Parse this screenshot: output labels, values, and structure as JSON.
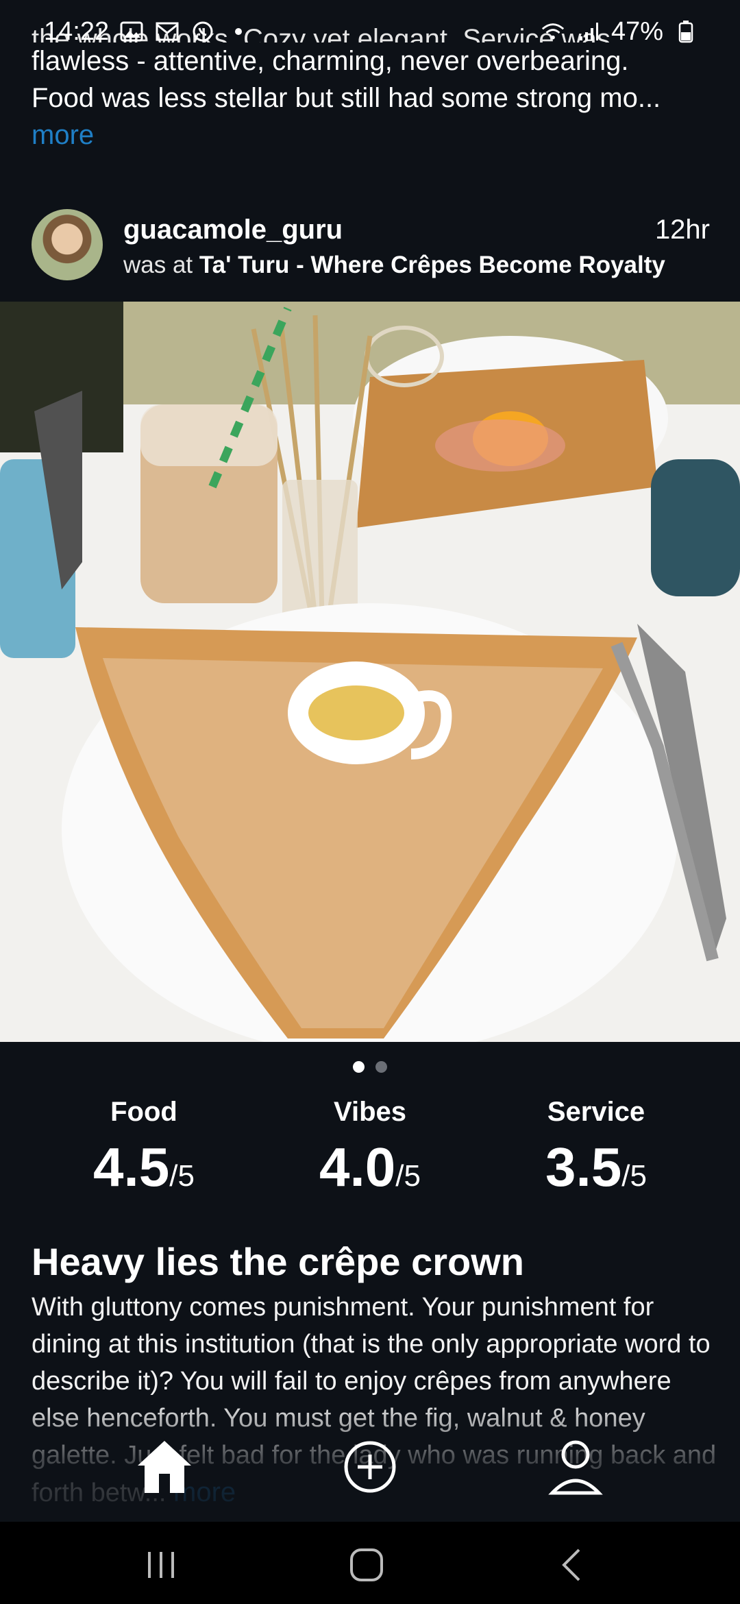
{
  "status_bar": {
    "time": "14:22",
    "battery": "47%",
    "icons_left": [
      "gallery-icon",
      "gmail-icon",
      "whatsapp-icon",
      "dot-icon"
    ],
    "icons_right": [
      "wifi-icon",
      "signal-icon",
      "battery-icon"
    ]
  },
  "review_tail": {
    "cut_line": "the whole works. Cozy yet elegant. Service was",
    "lines": [
      "flawless - attentive, charming, never overbearing.",
      "Food was less stellar but still had some strong mo..."
    ],
    "more_label": "more"
  },
  "post": {
    "username": "guacamole_guru",
    "was_at_prefix": "was at",
    "venue": "Ta' Turu - Where Crêpes Become Royalty",
    "time": "12hr",
    "carousel": {
      "count": 2,
      "active": 1
    },
    "ratings": [
      {
        "label": "Food",
        "score": "4.5",
        "out_of": "/5"
      },
      {
        "label": "Vibes",
        "score": "4.0",
        "out_of": "/5"
      },
      {
        "label": "Service",
        "score": "3.5",
        "out_of": "/5"
      }
    ],
    "headline": "Heavy lies the crêpe crown",
    "body": "With gluttony comes punishment. Your punishment for dining at this institution (that is the only appropriate word to describe it)? You will fail to enjoy crêpes from anywhere else henceforth. You must get the fig, walnut & honey galette. Just felt bad for the lady who was running back and forth betw...",
    "body_more": "more"
  },
  "tab_bar": {
    "items": [
      "home-icon",
      "add-post-icon",
      "profile-icon"
    ]
  },
  "nav_bar": {
    "items": [
      "recents-icon",
      "home-button-icon",
      "back-icon"
    ]
  },
  "colors": {
    "background": "#0d1117",
    "link": "#1f7fc6"
  }
}
